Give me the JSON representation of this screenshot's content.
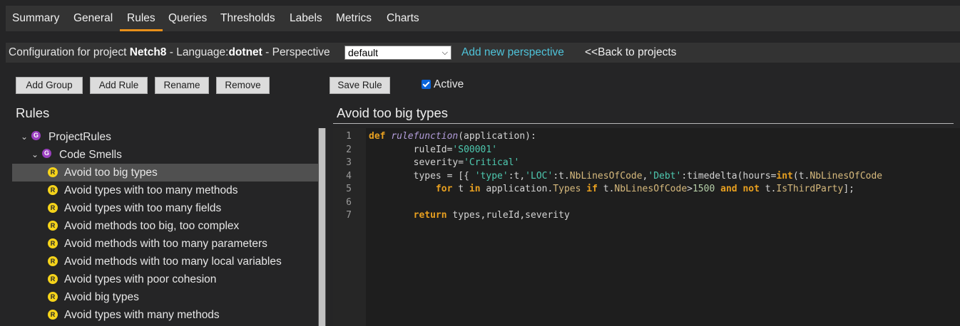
{
  "nav": {
    "tabs": [
      "Summary",
      "General",
      "Rules",
      "Queries",
      "Thresholds",
      "Labels",
      "Metrics",
      "Charts"
    ],
    "active": "Rules"
  },
  "config": {
    "prefix": "Configuration for project ",
    "project": "Netch8",
    "language_prefix": " - Language:",
    "language": "dotnet",
    "perspective_prefix": " - Perspective ",
    "perspective_value": "default",
    "add_perspective": "Add new perspective",
    "back": "<<Back to projects"
  },
  "toolbar": {
    "add_group": "Add Group",
    "add_rule": "Add Rule",
    "rename": "Rename",
    "remove": "Remove",
    "save_rule": "Save Rule",
    "active_label": "Active",
    "active_checked": true
  },
  "rules_panel": {
    "title": "Rules",
    "root": {
      "badge": "G",
      "label": "ProjectRules"
    },
    "group": {
      "badge": "G",
      "label": "Code Smells"
    },
    "rules": [
      {
        "badge": "R",
        "label": "Avoid too big types",
        "selected": true
      },
      {
        "badge": "R",
        "label": "Avoid types with too many methods"
      },
      {
        "badge": "R",
        "label": "Avoid types with too many fields"
      },
      {
        "badge": "R",
        "label": "Avoid methods too big, too complex"
      },
      {
        "badge": "R",
        "label": "Avoid methods with too many parameters"
      },
      {
        "badge": "R",
        "label": "Avoid methods with too many local variables"
      },
      {
        "badge": "R",
        "label": "Avoid types with poor cohesion"
      },
      {
        "badge": "R",
        "label": "Avoid big types"
      },
      {
        "badge": "R",
        "label": "Avoid types with many methods"
      }
    ]
  },
  "editor": {
    "title": "Avoid too big types",
    "line_numbers": [
      "1",
      "2",
      "3",
      "4",
      "5",
      "6",
      "7"
    ],
    "code": {
      "l1_def": "def",
      "l1_fn": "rulefunction",
      "l1_rest": "(application):",
      "l2_indent": "        ",
      "l2_key": "ruleId=",
      "l2_val": "'S00001'",
      "l3_indent": "        ",
      "l3_key": "severity=",
      "l3_val": "'Critical'",
      "l4_indent": "        ",
      "l4_a": "types = [{ ",
      "l4_s1": "'type'",
      "l4_b": ":t,",
      "l4_s2": "'LOC'",
      "l4_c": ":t.",
      "l4_p1": "NbLinesOfCode",
      "l4_d": ",",
      "l4_s3": "'Debt'",
      "l4_e": ":timedelta(hours=",
      "l4_k1": "int",
      "l4_f": "(t.",
      "l4_p2": "NbLinesOfCode",
      "l5_indent": "            ",
      "l5_k1": "for",
      "l5_a": " t ",
      "l5_k2": "in",
      "l5_b": " application.",
      "l5_p1": "Types",
      "l5_c": " ",
      "l5_k3": "if",
      "l5_d": " t.",
      "l5_p2": "NbLinesOfCode",
      "l5_e": ">",
      "l5_n1": "1500",
      "l5_f": " ",
      "l5_k4": "and",
      "l5_g": " ",
      "l5_k5": "not",
      "l5_h": " t.",
      "l5_p3": "IsThirdParty",
      "l5_i": "];",
      "l7_indent": "        ",
      "l7_kw": "return",
      "l7_rest": " types,ruleId,severity"
    }
  }
}
